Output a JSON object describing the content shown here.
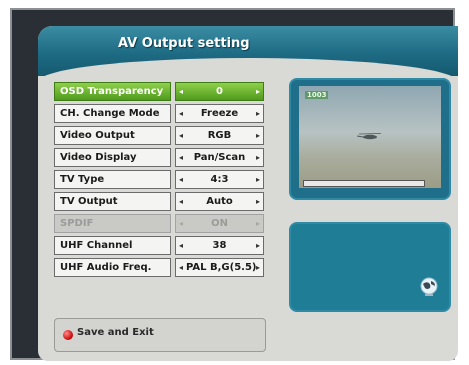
{
  "header": {
    "title": "AV Output setting"
  },
  "settings": [
    {
      "label": "OSD Transparency",
      "value": "0",
      "active": true
    },
    {
      "label": "CH. Change Mode",
      "value": "Freeze"
    },
    {
      "label": "Video Output",
      "value": "RGB"
    },
    {
      "label": "Video Display",
      "value": "Pan/Scan"
    },
    {
      "label": "TV Type",
      "value": "4:3"
    },
    {
      "label": "TV Output",
      "value": "Auto"
    },
    {
      "label": "SPDIF",
      "value": "ON",
      "disabled": true
    },
    {
      "label": "UHF Channel",
      "value": "38"
    },
    {
      "label": "UHF Audio Freq.",
      "value": "PAL B,G(5.5)"
    }
  ],
  "arrows": {
    "left": "◂",
    "right": "▸"
  },
  "preview": {
    "channel_tag": "1003"
  },
  "footer": {
    "save_exit_label": "Save and Exit"
  },
  "colors": {
    "accent": "#4f9a1d",
    "header": "#1e6b84",
    "panel": "#d9d9d6",
    "save_key": "#c70000"
  },
  "icons": {
    "save_key": "red-button-icon",
    "globe": "globe-icon"
  }
}
